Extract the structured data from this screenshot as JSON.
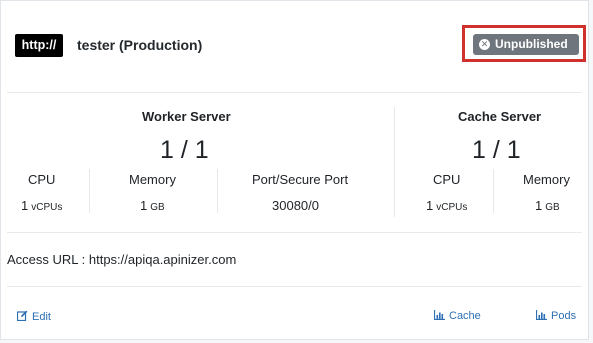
{
  "header": {
    "protocol_badge": "http://",
    "title": "tester (Production)",
    "status_label": "Unpublished",
    "status_icon": "x-circle-icon",
    "highlight_color": "#d0312d"
  },
  "worker": {
    "title": "Worker Server",
    "ratio": "1 / 1",
    "cpu_label": "CPU",
    "cpu_value": "1",
    "cpu_unit": "vCPUs",
    "memory_label": "Memory",
    "memory_value": "1",
    "memory_unit": "GB",
    "port_label": "Port/Secure Port",
    "port_value": "30080/0"
  },
  "cache": {
    "title": "Cache Server",
    "ratio": "1 / 1",
    "cpu_label": "CPU",
    "cpu_value": "1",
    "cpu_unit": "vCPUs",
    "memory_label": "Memory",
    "memory_value": "1",
    "memory_unit": "GB"
  },
  "access": {
    "text": "Access URL : https://apiqa.apinizer.com"
  },
  "footer": {
    "edit_label": "Edit",
    "cache_label": "Cache",
    "pods_label": "Pods"
  }
}
